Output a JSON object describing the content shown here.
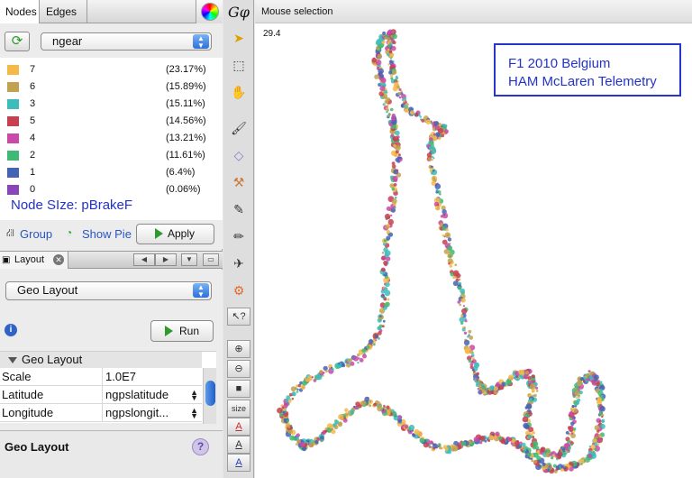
{
  "tabs": {
    "nodes": "Nodes",
    "edges": "Edges"
  },
  "partition": {
    "attribute": "ngear"
  },
  "legend": [
    {
      "label": "7",
      "percent": "(23.17%)",
      "color": "#f5b94a"
    },
    {
      "label": "6",
      "percent": "(15.89%)",
      "color": "#c2a24e"
    },
    {
      "label": "3",
      "percent": "(15.11%)",
      "color": "#3dbcbc"
    },
    {
      "label": "5",
      "percent": "(14.56%)",
      "color": "#c8404f"
    },
    {
      "label": "4",
      "percent": "(13.21%)",
      "color": "#c94aa8"
    },
    {
      "label": "2",
      "percent": "(11.61%)",
      "color": "#3fba74"
    },
    {
      "label": "1",
      "percent": "(6.4%)",
      "color": "#4563b5"
    },
    {
      "label": "0",
      "percent": "(0.06%)",
      "color": "#8a45b8"
    }
  ],
  "node_size_note": "Node SIze: pBrakeF",
  "actions": {
    "group": "Group",
    "show_pie": "Show Pie",
    "apply": "Apply"
  },
  "layout_panel": {
    "tab_label": "Layout",
    "selected_layout": "Geo Layout",
    "run": "Run",
    "section": "Geo Layout",
    "properties": [
      {
        "key": "Scale",
        "value": "1.0E7"
      },
      {
        "key": "Latitude",
        "value": "ngpslatitude"
      },
      {
        "key": "Longitude",
        "value": "ngpslongit..."
      }
    ],
    "description_title": "Geo Layout"
  },
  "toolbar": {
    "tools": [
      "arrow-select-icon",
      "rect-select-icon",
      "drag-hand-icon",
      "brush-icon",
      "diamond-icon",
      "painter-icon",
      "pencil-icon",
      "pencil-alt-icon",
      "airplane-icon",
      "gear-icon",
      "help-cursor-icon",
      "zoom-in-icon",
      "zoom-reset-icon",
      "stop-icon",
      "size-icon",
      "text-color-icon",
      "text-icon",
      "text-size-icon"
    ],
    "size_label": "size",
    "text_glyph": "A"
  },
  "graph": {
    "mode": "Mouse selection",
    "zoom_value": "29.4",
    "annotation_line1": "F1 2010 Belgium",
    "annotation_line2": "HAM McLaren Telemetry"
  }
}
